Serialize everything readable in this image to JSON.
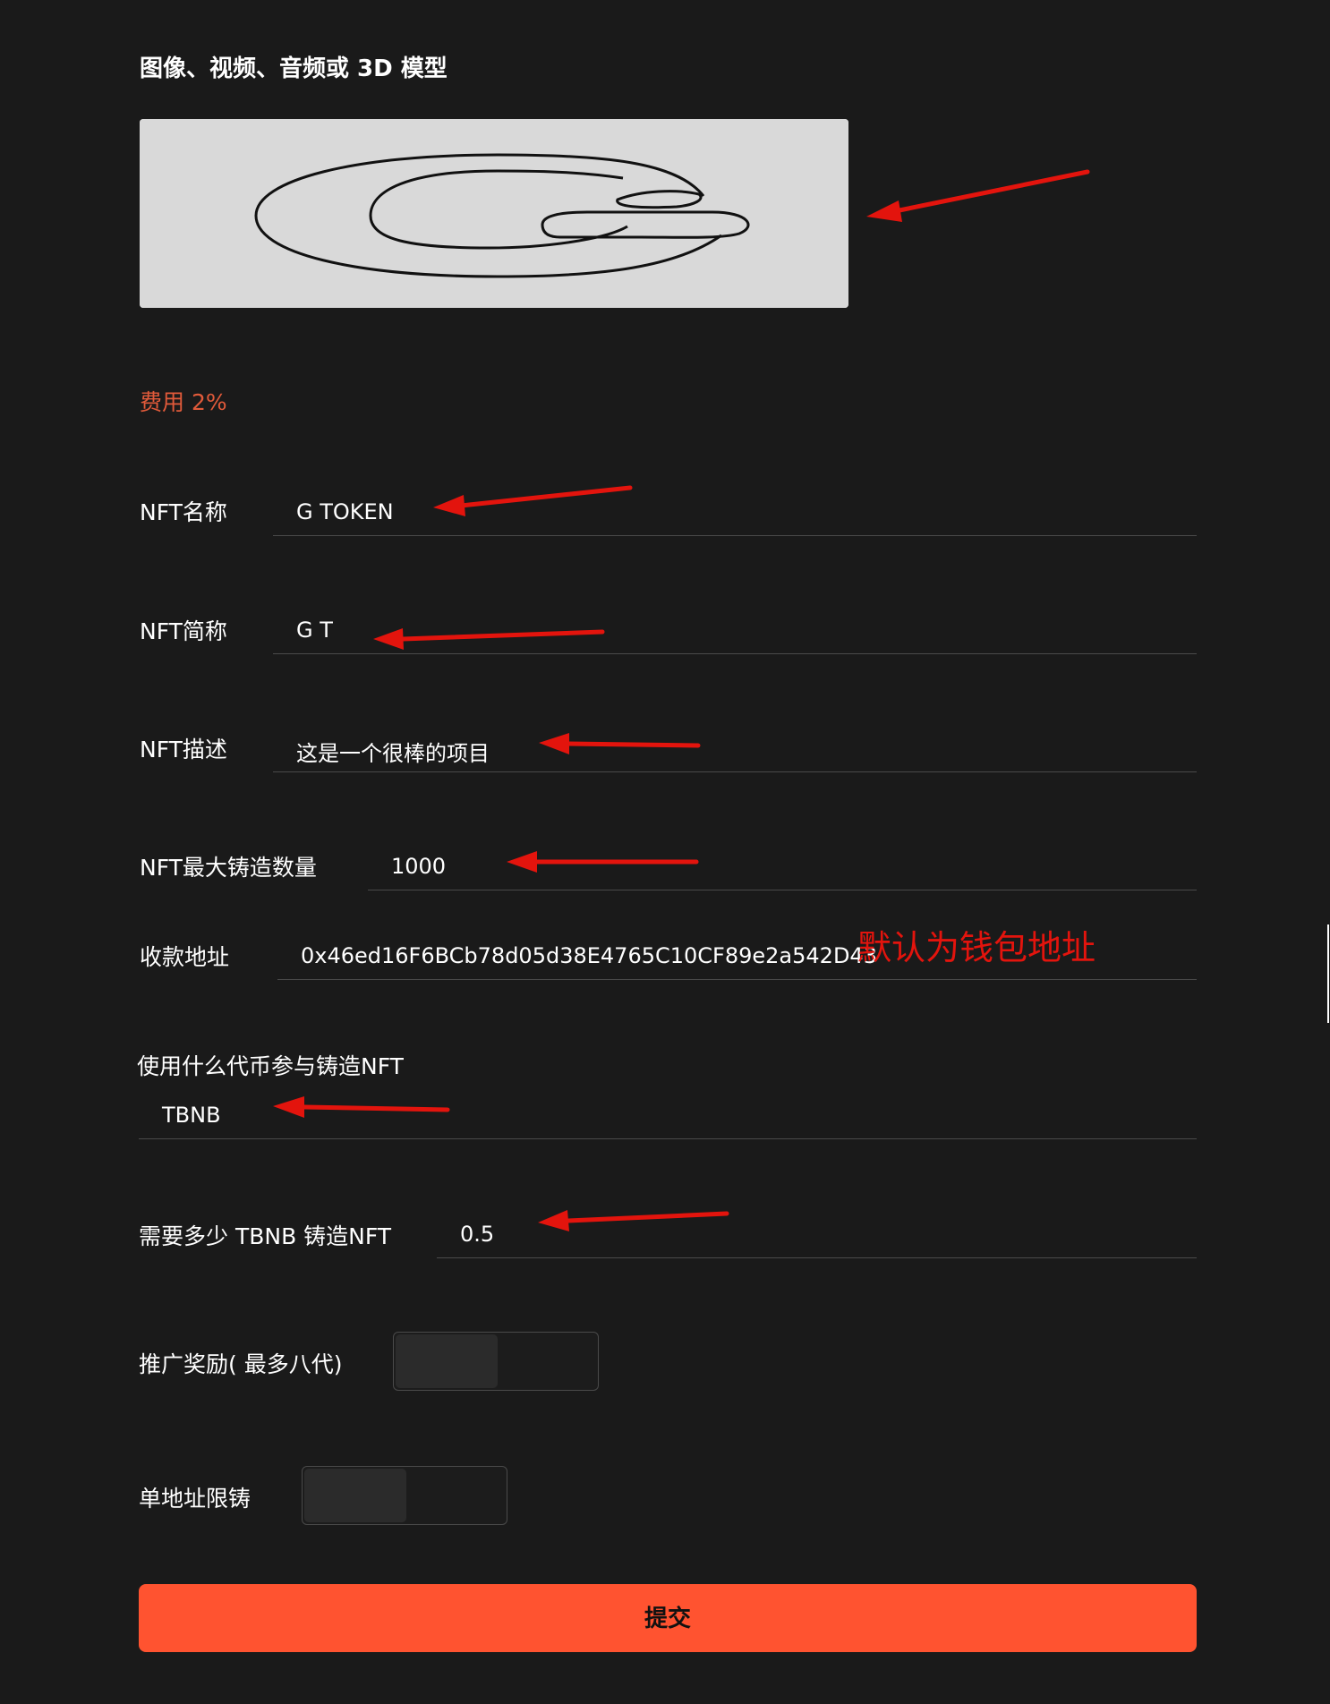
{
  "media": {
    "title": "图像、视频、音频或 3D 模型"
  },
  "fee": {
    "label": "费用 2%"
  },
  "form": {
    "nft_name": {
      "label": "NFT名称",
      "value": "G TOKEN"
    },
    "nft_symbol": {
      "label": "NFT简称",
      "value": "G T"
    },
    "nft_description": {
      "label": "NFT描述",
      "value": "这是一个很棒的项目"
    },
    "nft_max_supply": {
      "label": "NFT最大铸造数量",
      "value": "1000"
    },
    "payee_address": {
      "label": "收款地址",
      "value": "0x46ed16F6BCb78d05d38E4765C10CF89e2a542D43"
    },
    "mint_token": {
      "label": "使用什么代币参与铸造NFT",
      "value": "TBNB"
    },
    "mint_price": {
      "label": "需要多少 TBNB 铸造NFT",
      "value": "0.5"
    },
    "referral_reward": {
      "label": "推广奖励( 最多八代)",
      "enabled": false
    },
    "per_address_limit": {
      "label": "单地址限铸",
      "enabled": false
    }
  },
  "annotation": {
    "text": "默认为钱包地址",
    "color": "#e3140d"
  },
  "submit": {
    "label": "提交"
  },
  "colors": {
    "background": "#1a1a1a",
    "accent": "#ff5330",
    "fee_text": "#e05a3a",
    "arrow": "#e3140d"
  }
}
